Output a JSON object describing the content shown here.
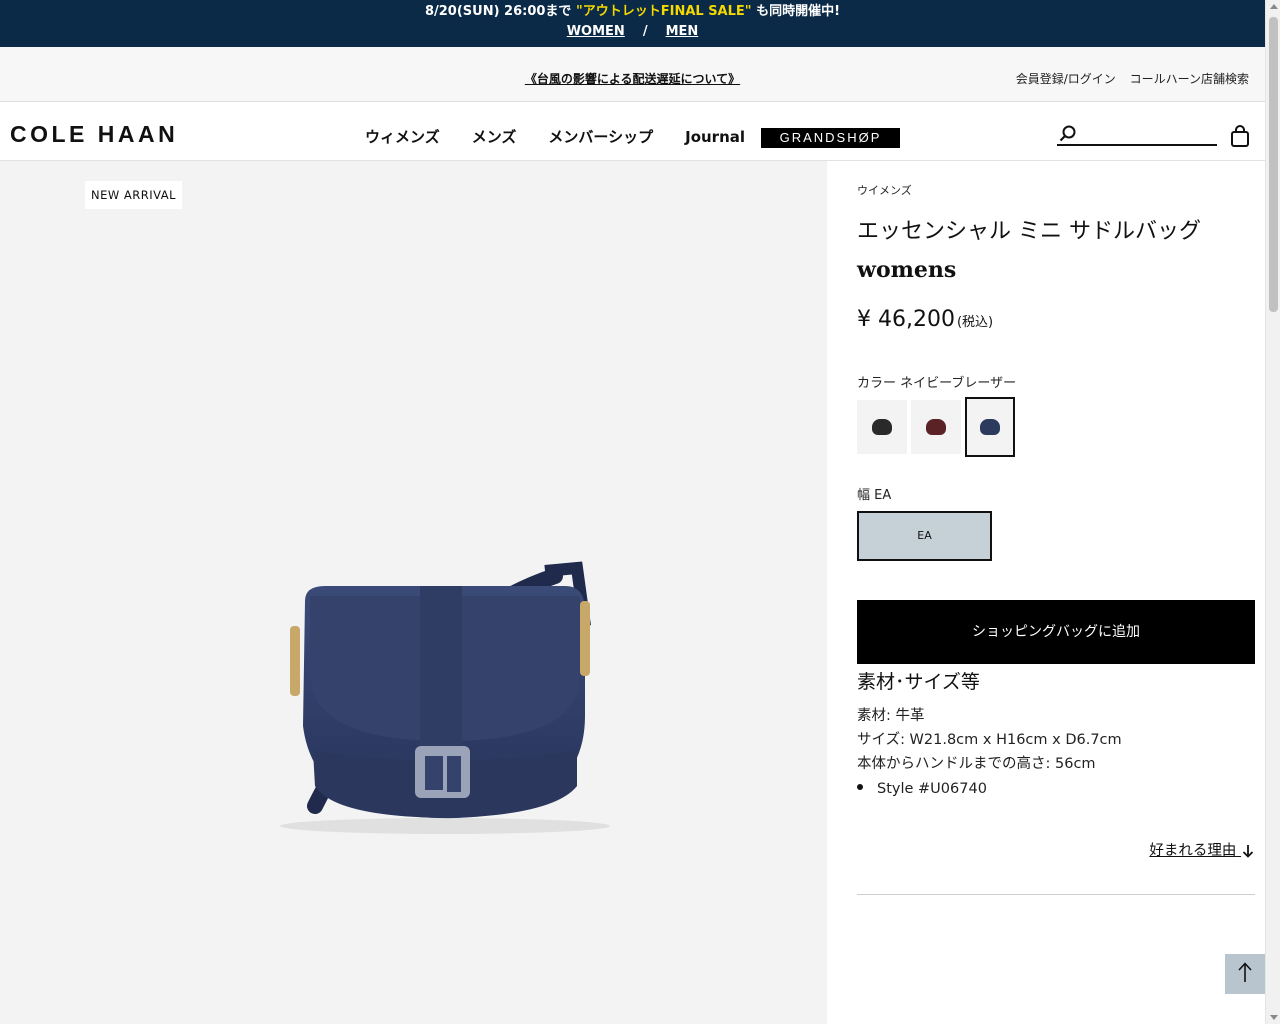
{
  "promo": {
    "prefix": "8/20(SUN) 26:00まで ",
    "highlight": "\"アウトレットFINAL SALE\"",
    "suffix": " も同時開催中!",
    "women_link": "WOMEN",
    "separator": "/",
    "men_link": "MEN",
    "highlight_color": "#f5d800",
    "bg_color": "#0a2a47"
  },
  "utility": {
    "notice": "《台風の影響による配送遅延について》",
    "login": "会員登録/ログイン",
    "store_search": "コールハーン店舗検索"
  },
  "nav": {
    "logo": "COLE HAAN",
    "items": [
      "ウィメンズ",
      "メンズ",
      "メンバーシップ",
      "Journal"
    ],
    "grandshop": "GRANDSHØP",
    "search_placeholder": "",
    "search_icon": "search-icon",
    "bag_icon": "shopping-bag-icon"
  },
  "gallery": {
    "badge": "NEW ARRIVAL",
    "image": "navy-leather-saddle-bag"
  },
  "product": {
    "breadcrumb": "ウイメンズ",
    "name": "エッセンシャル ミニ サドルバッグ",
    "gender": "womens",
    "price": "¥ 46,200",
    "tax_note": "(税込)",
    "color_label": "カラー ネイビーブレーザー",
    "swatches": [
      {
        "name": "black",
        "color": "#2a2a2a",
        "selected": false
      },
      {
        "name": "burgundy",
        "color": "#5b2226",
        "selected": false
      },
      {
        "name": "navy",
        "color": "#2c3a5e",
        "selected": true
      }
    ],
    "width_label": "幅 EA",
    "width_option": "EA",
    "add_to_bag": "ショッピングバッグに追加",
    "materials_heading": "素材･サイズ等",
    "material": "素材: 牛革",
    "size": "サイズ: W21.8cm x H16cm x D6.7cm",
    "handle_height": "本体からハンドルまでの高さ: 56cm",
    "style": "Style #U06740",
    "why_loved": "好まれる理由",
    "why_icon": "arrow-down-icon"
  },
  "back_to_top_icon": "arrow-up-icon"
}
